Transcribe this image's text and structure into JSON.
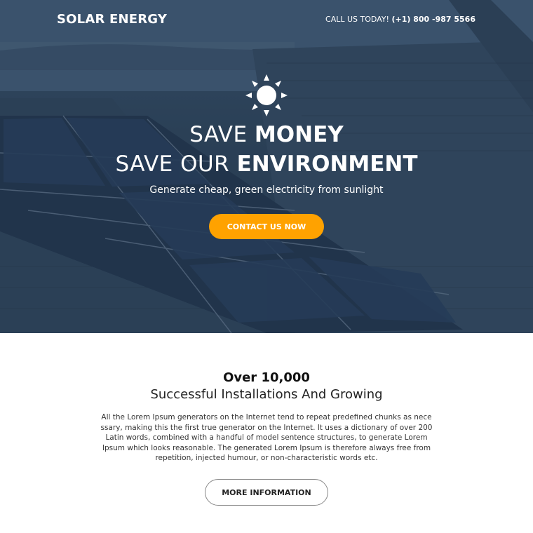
{
  "header": {
    "logo": "SOLAR ENERGY",
    "call_label": "CALL US TODAY!",
    "call_phone": "(+1) 800 -987 5566"
  },
  "hero": {
    "headline_1_light": "SAVE ",
    "headline_1_bold": "MONEY",
    "headline_2_light": "SAVE OUR ",
    "headline_2_bold": "ENVIRONMENT",
    "subline": "Generate cheap, green electricity from sunlight",
    "cta_label": "CONTACT US NOW",
    "sun_icon": "sun-icon"
  },
  "stats": {
    "number": "Over 10,000",
    "caption": "Successful Installations And Growing",
    "body": "All the Lorem Ipsum generators on the Internet tend to repeat predefined chunks as nece ssary, making this the first true generator on the Internet. It uses a dictionary of over 200 Latin words, combined with a handful of model sentence structures, to generate Lorem Ipsum which looks reasonable. The generated Lorem Ipsum is therefore always free from repetition, injected humour, or non-characteristic words etc.",
    "button_label": "MORE INFORMATION"
  },
  "colors": {
    "accent": "#ffa200",
    "hero_overlay": "#2e4560"
  }
}
